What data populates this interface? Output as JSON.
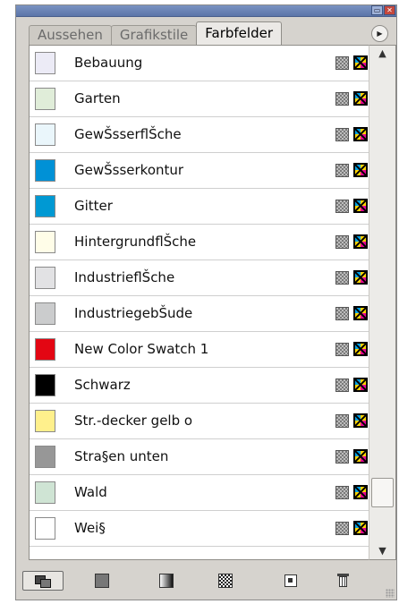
{
  "panel": {
    "tabs": [
      {
        "label": "Aussehen",
        "active": false
      },
      {
        "label": "Grafikstile",
        "active": false
      },
      {
        "label": "Farbfelder",
        "active": true
      }
    ]
  },
  "swatches": [
    {
      "name": "Bebauung",
      "color": "#ecebf6"
    },
    {
      "name": "Garten",
      "color": "#e0edd9"
    },
    {
      "name": "GewŠsserflŠche",
      "color": "#eaf6fb"
    },
    {
      "name": "GewŠsserkontur",
      "color": "#0091d6"
    },
    {
      "name": "Gitter",
      "color": "#0099d3"
    },
    {
      "name": "HintergrundflŠche",
      "color": "#fffde8"
    },
    {
      "name": "IndustrieflŠche",
      "color": "#e2e2e4"
    },
    {
      "name": "IndustriegebŠude",
      "color": "#cbcccd"
    },
    {
      "name": "New Color Swatch 1",
      "color": "#e30613"
    },
    {
      "name": "Schwarz",
      "color": "#000000"
    },
    {
      "name": "Str.-decker gelb  o",
      "color": "#fff08c"
    },
    {
      "name": "Stra§en unten",
      "color": "#979797"
    },
    {
      "name": "Wald",
      "color": "#cfe4d4"
    },
    {
      "name": "Wei§",
      "color": "#ffffff"
    }
  ],
  "icons": {
    "global_type": "global-process-color-icon",
    "color_mode": "cmyk-process-icon"
  },
  "toolbar": {
    "buttons": [
      "show-swatch-kinds-icon",
      "color-swatches-icon",
      "gradient-swatches-icon",
      "pattern-swatches-icon",
      "new-swatch-icon",
      "trash-icon"
    ]
  },
  "scrollbar": {
    "position": 0.92
  }
}
